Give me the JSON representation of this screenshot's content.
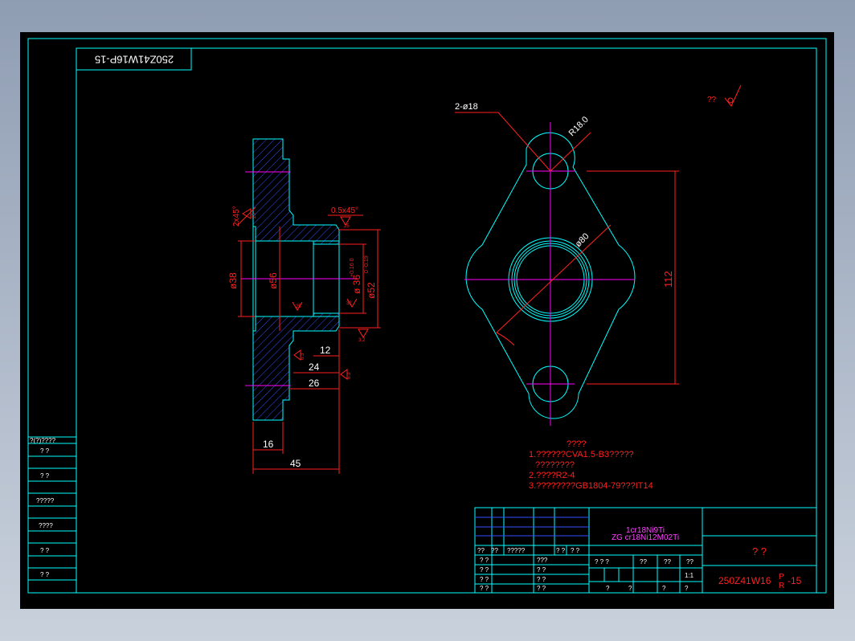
{
  "colors": {
    "canvas": "#000000",
    "border": "#00ffff",
    "dimension": "#ff2020",
    "centerline": "#ff00ff",
    "hatch": "#3050ff",
    "text": "#ffffff"
  },
  "drawing": {
    "rotated_title": "250Z41W16P-15",
    "section_labels": {
      "chamfer_left": "2x45°",
      "chamfer_top": "0.5x45°",
      "dia_38": "ø38",
      "dia_56": "ø56",
      "dia_36": "ø 36",
      "dia_36_tol": "+0.16 0",
      "dia_52": "ø52",
      "dia_52_tol": "0 -0.19",
      "dim_12": "12",
      "dim_24": "24",
      "dim_26": "26",
      "dim_16": "16",
      "dim_45": "45",
      "rough_25a": "25",
      "rough_25b": "25",
      "rough_32a": "32",
      "rough_32b": "3.2",
      "rough_63a": "6.3",
      "rough_63b": "6.3",
      "rough_63c": "6.3",
      "rough_side": "25"
    },
    "plan_labels": {
      "holes": "2-ø18",
      "radius": "R18.0",
      "dia_80": "ø80",
      "dim_112": "112"
    },
    "roughness_note": "??",
    "notes": {
      "heading": "????",
      "line1": "1.??????CVA1.5-B3?????",
      "line2": "????????",
      "line3": "2.????R2-4",
      "line4": "3.????????GB1804-79???IT14"
    }
  },
  "left_strip": {
    "header": "?(?)????",
    "items": [
      "?  ?",
      "?  ?",
      "?????",
      "????",
      "?  ?",
      "?  ?"
    ]
  },
  "title_block": {
    "material_line1": "1cr18Ni9Ti",
    "material_line2": "ZG cr18Ni12M02Ti",
    "header_row": [
      "??",
      "??",
      "?????",
      "? ?",
      "? ?"
    ],
    "rows": [
      [
        "? ?",
        "???"
      ],
      [
        "? ?",
        "? ?"
      ],
      [
        "? ?",
        "? ?"
      ],
      [
        "? ?",
        "? ?"
      ]
    ],
    "mid_header": [
      "? ? ?",
      "??",
      "??",
      "??"
    ],
    "scale": "1:1",
    "bottom_row": [
      "?",
      "?",
      "?",
      "?"
    ],
    "name": "?    ?",
    "code": "250Z41W16",
    "code_top": "P",
    "code_bottom": "R",
    "code_suffix": "-15"
  }
}
